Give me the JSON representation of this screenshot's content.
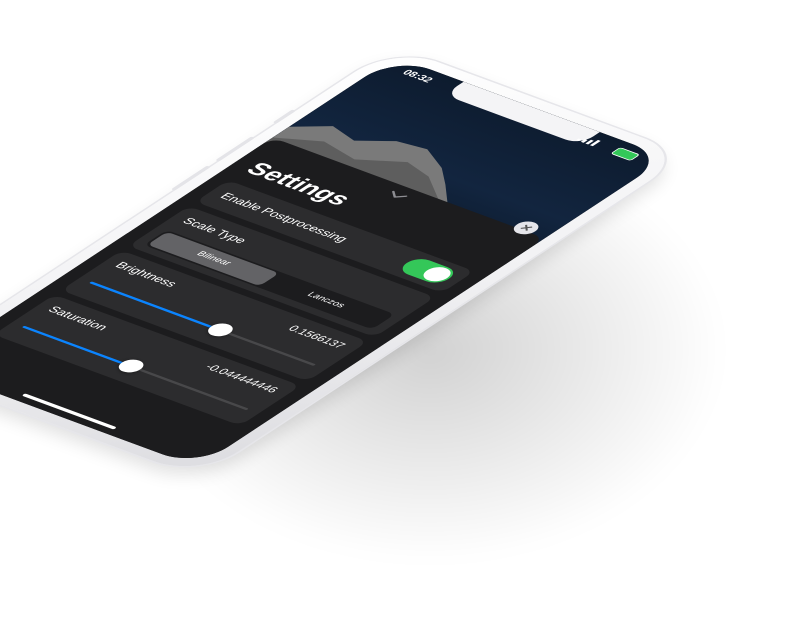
{
  "status_bar": {
    "time": "08:32"
  },
  "sheet": {
    "title": "Settings",
    "close_icon": "xmark-icon",
    "handle_icon": "chevron-down-icon",
    "postprocessing": {
      "label": "Enable Postprocessing",
      "enabled": true
    },
    "scale_type": {
      "label": "Scale Type",
      "options": [
        "Bilinear",
        "Lanczos"
      ],
      "selected": "Bilinear"
    },
    "brightness": {
      "label": "Brightness",
      "value_text": "0.1566137",
      "range": [
        -1,
        1
      ],
      "value": 0.1566137
    },
    "saturation": {
      "label": "Saturation",
      "value_text": "-0.044444446",
      "range": [
        -1,
        1
      ],
      "value": -0.044444446
    }
  },
  "colors": {
    "accent": "#0a84ff",
    "toggle_on": "#34c759",
    "sheet_bg": "#1c1c1e",
    "row_bg": "#2c2c2e"
  }
}
